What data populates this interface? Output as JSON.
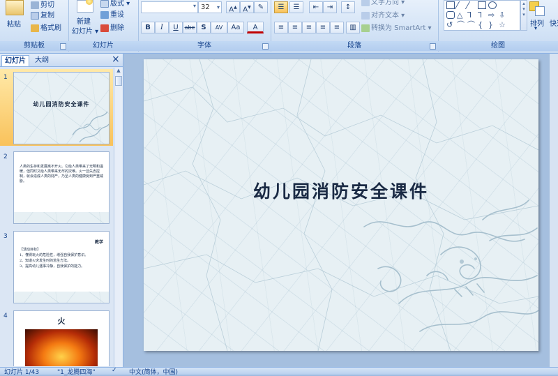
{
  "ribbon": {
    "clipboard": {
      "paste": "粘贴",
      "cut": "剪切",
      "copy": "复制",
      "format_painter": "格式刷",
      "group_label": "剪贴板"
    },
    "slides": {
      "new_slide_line1": "新建",
      "new_slide_line2": "幻灯片",
      "layout": "版式",
      "reset": "重设",
      "delete": "删除",
      "group_label": "幻灯片"
    },
    "font": {
      "font_size": "32",
      "bold": "B",
      "italic": "I",
      "underline": "U",
      "strike": "abe",
      "shadow": "S",
      "spacing": "AV",
      "case": "Aa",
      "color": "A",
      "group_label": "字体"
    },
    "paragraph": {
      "text_direction": "文字方向",
      "align_text": "对齐文本",
      "smartart": "转换为 SmartArt",
      "group_label": "段落"
    },
    "drawing": {
      "arrange": "排列",
      "quick_styles": "快速",
      "group_label": "绘图"
    }
  },
  "leftpane": {
    "tabs": [
      "幻灯片",
      "大纲"
    ],
    "close": "×",
    "thumbs": [
      {
        "num": "1",
        "title": "幼儿园消防安全课件"
      },
      {
        "num": "2",
        "body": "人类的生存和发展离不开火。它给人类带来了光明和温暖，但同时又给人类带来无尽的灾难。火一旦失去控制，就会造成人类的财产，乃至人类的健康受到严重威胁。"
      },
      {
        "num": "3",
        "heading": "教学",
        "lines": [
          "【活动目标】",
          "1、懂得玩火的危险性，增强自我保护意识。",
          "2、知道火灾发生时的逃生方法。",
          "3、提高幼儿遇事冷静，自我保护的能力。"
        ]
      },
      {
        "num": "4",
        "heading": "火"
      }
    ]
  },
  "slide": {
    "title": "幼儿园消防安全课件"
  },
  "status": {
    "slide_count": "幻灯片 1/43",
    "theme": "\"1_龙腾四海\"",
    "language": "中文(简体，中国)"
  },
  "colors": {
    "ribbon_bg": "#d3e3f6",
    "accent": "#15428b",
    "selection": "#f9c25b",
    "slide_bg": "#e7f0f4"
  }
}
